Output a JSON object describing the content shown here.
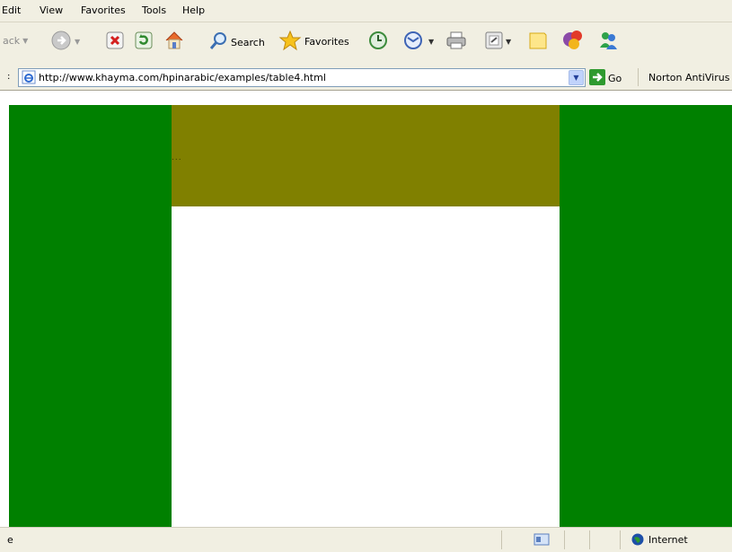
{
  "menu": {
    "items": [
      "Edit",
      "View",
      "Favorites",
      "Tools",
      "Help"
    ]
  },
  "toolbar": {
    "back_label": "ack",
    "search_label": "Search",
    "favorites_label": "Favorites"
  },
  "address": {
    "url": "http://www.khayma.com/hpinarabic/examples/table4.html",
    "go_label": "Go",
    "norton_label": "Norton AntiVirus"
  },
  "page": {
    "band_text": "...",
    "colors": {
      "side_columns": "#008000",
      "top_band": "#808000",
      "center": "#ffffff"
    }
  },
  "status": {
    "left_text": "e",
    "zone_label": "Internet"
  },
  "icons": [
    "back-icon",
    "forward-icon",
    "stop-icon",
    "refresh-icon",
    "home-icon",
    "search-icon",
    "favorites-star-icon",
    "history-icon",
    "mail-icon",
    "print-icon",
    "edit-icon",
    "notes-icon",
    "messenger-icon",
    "msn-people-icon",
    "ie-page-icon",
    "go-arrow-icon",
    "internet-globe-icon"
  ]
}
